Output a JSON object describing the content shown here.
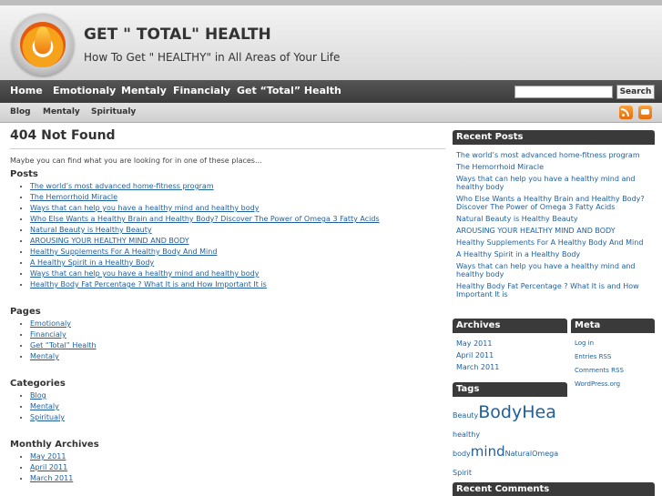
{
  "site": {
    "title": "GET \" TOTAL\" HEALTH",
    "description": "How To Get \" HEALTHY\" in All Areas of Your Life"
  },
  "nav": {
    "items": [
      "Home",
      "Emotionaly",
      "Mentaly",
      "Financialy",
      "Get “Total” Health"
    ],
    "search_value": "",
    "search_label": "Search"
  },
  "subnav": {
    "items": [
      "Blog",
      "Mentaly",
      "Spiritualy"
    ]
  },
  "main": {
    "title": "404 Not Found",
    "intro": "Maybe you can find what you are looking for in one of these places...",
    "posts_heading": "Posts",
    "posts": [
      "The world’s most advanced home-fitness program",
      "The Hemorrhoid Miracle",
      "Ways that can help you have a healthy mind and healthy body",
      "Who Else Wants a Healthy Brain and Healthy Body? Discover The Power of Omega 3 Fatty Acids",
      "Natural Beauty is Healthy Beauty",
      "AROUSING YOUR HEALTHY MIND AND BODY",
      "Healthy Supplements For A Healthy Body And Mind",
      "A Healthy Spirit in a Healthy Body",
      "Ways that can help you have a healthy mind and healthy body",
      "Healthy Body Fat Percentage ? What It is and How Important It is"
    ],
    "pages_heading": "Pages",
    "pages": [
      "Emotionaly",
      "Financialy",
      "Get “Total” Health",
      "Mentaly"
    ],
    "categories_heading": "Categories",
    "categories": [
      "Blog",
      "Mentaly",
      "Spiritualy"
    ],
    "archives_heading": "Monthly Archives",
    "archives": [
      "May 2011",
      "April 2011",
      "March 2011"
    ]
  },
  "sidebar": {
    "recent_posts_heading": "Recent Posts",
    "recent_posts": [
      "The world’s most advanced home-fitness program",
      "The Hemorrhoid Miracle",
      "Ways that can help you have a healthy mind and healthy body",
      "Who Else Wants a Healthy Brain and Healthy Body? Discover The Power of Omega 3 Fatty Acids",
      "Natural Beauty is Healthy Beauty",
      "AROUSING YOUR HEALTHY MIND AND BODY",
      "Healthy Supplements For A Healthy Body And Mind",
      "A Healthy Spirit in a Healthy Body",
      "Ways that can help you have a healthy mind and healthy body",
      "Healthy Body Fat Percentage ? What It is and How Important It is"
    ],
    "archives_heading": "Archives",
    "archives": [
      "May 2011",
      "April 2011",
      "March 2011"
    ],
    "meta_heading": "Meta",
    "meta": [
      "Log in",
      "Entries RSS",
      "Comments RSS",
      "WordPress.org"
    ],
    "tags_heading": "Tags",
    "tags": {
      "beauty": "Beauty",
      "bodyhealth": "BodyHea",
      "healthy": "healthy",
      "body": "body",
      "mind": "mind",
      "natural": "Natural",
      "omega": "Omega",
      "spirit": "Spirit"
    },
    "recent_comments_heading": "Recent Comments"
  },
  "colors": {
    "link": "#1e5f9e",
    "nav_bg": "#444444",
    "sidebar_head_bg": "#3a3a3a"
  },
  "icons": [
    "logo-flame-icon",
    "rss-icon",
    "comment-feed-icon"
  ]
}
